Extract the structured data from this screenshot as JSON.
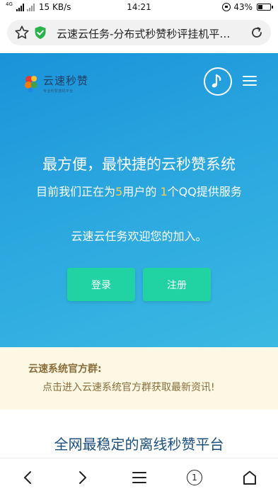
{
  "status_bar": {
    "network": "4G",
    "speed": "15 KB/s",
    "time": "14:21",
    "battery": "43%",
    "battery_level": 0.43
  },
  "browser": {
    "page_title": "云速云任务-分布式秒赞秒评挂机平…",
    "star_icon": "star-icon",
    "shield_icon": "shield-check-icon",
    "reload_icon": "reload-icon"
  },
  "header": {
    "logo_name": "云速秒赞",
    "logo_tagline": "专业秒赞挂机平台",
    "music_icon": "music-note-icon",
    "menu_icon": "hamburger-menu-icon"
  },
  "hero": {
    "title": "最方便，最快捷的云秒赞系统",
    "stats_prefix": "目前我们正在为",
    "user_count": "5",
    "stats_middle": "用户的 ",
    "qq_count": "1",
    "stats_suffix": "个QQ提供服务",
    "welcome": "云速云任务欢迎您的加入。",
    "login_label": "登录",
    "register_label": "注册"
  },
  "group_notice": {
    "title": "云速系统官方群:",
    "link_text": "点击进入云速系统官方群获取最新资讯!"
  },
  "section": {
    "title": "全网最稳定的离线秒赞平台"
  },
  "bottom_nav": {
    "tab_count": "1",
    "icons": [
      "chevron-left-icon",
      "chevron-right-icon",
      "menu-icon",
      "tabs-icon",
      "home-icon"
    ]
  },
  "colors": {
    "hero_start": "#1a93d9",
    "hero_end": "#3bb9e2",
    "button": "#21d3a3",
    "highlight_number": "#f6d24a",
    "notice_bg": "#fcf8e3",
    "notice_text": "#8a6d3b",
    "section_title": "#1b4f7f"
  }
}
